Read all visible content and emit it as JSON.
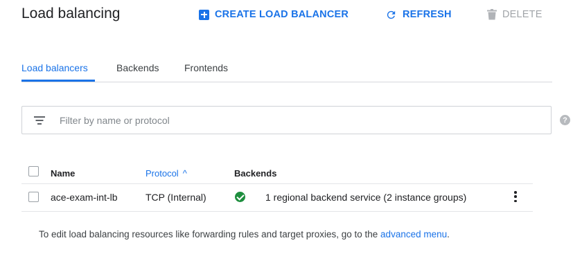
{
  "header": {
    "title": "Load balancing",
    "create_label": "CREATE LOAD BALANCER",
    "refresh_label": "REFRESH",
    "delete_label": "DELETE"
  },
  "tabs": [
    {
      "label": "Load balancers",
      "active": true
    },
    {
      "label": "Backends",
      "active": false
    },
    {
      "label": "Frontends",
      "active": false
    }
  ],
  "filter": {
    "placeholder": "Filter by name or protocol",
    "value": "",
    "help_icon": "help-icon",
    "help_glyph": "?"
  },
  "table": {
    "columns": [
      "Name",
      "Protocol",
      "Backends"
    ],
    "sort": {
      "column": "Protocol",
      "direction": "ascending",
      "glyph": "^"
    },
    "rows": [
      {
        "name": "ace-exam-int-lb",
        "protocol": "TCP (Internal)",
        "status": "ok",
        "backends": "1 regional backend service (2 instance groups)"
      }
    ]
  },
  "footer": {
    "text_before_link": "To edit load balancing resources like forwarding rules and target proxies, go to the ",
    "link_text": "advanced menu",
    "text_after_link": "."
  },
  "colors": {
    "accent": "#1a73e8",
    "status_ok": "#1e8e3e",
    "disabled": "#a0a4a8"
  }
}
